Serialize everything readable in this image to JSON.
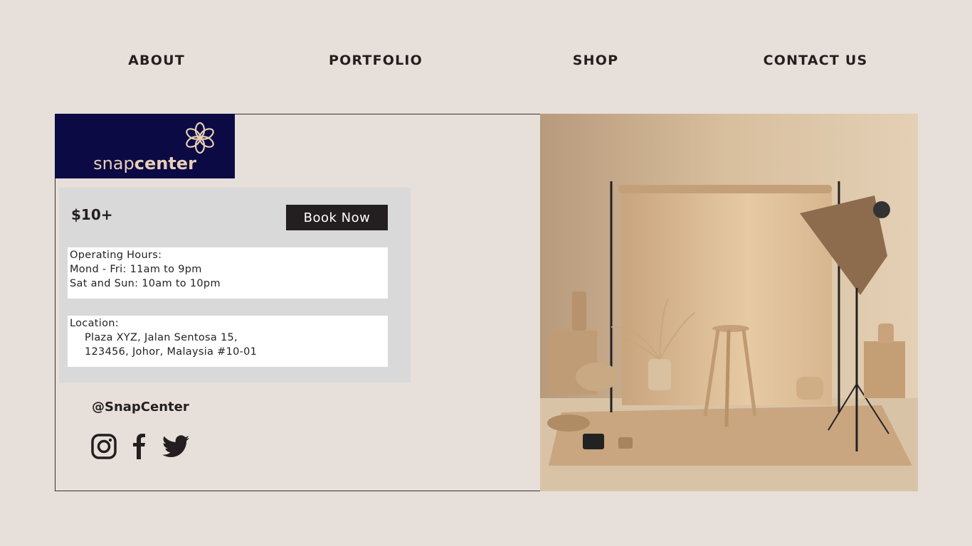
{
  "nav": {
    "items": [
      {
        "label": "ABOUT"
      },
      {
        "label": "PORTFOLIO"
      },
      {
        "label": "SHOP"
      },
      {
        "label": "CONTACT US"
      }
    ]
  },
  "logo": {
    "text_light": "snap",
    "text_bold": "center",
    "icon": "flower-logo-icon",
    "bg_color": "#0b0a45",
    "accent": "#e8cfb5"
  },
  "booking": {
    "price": "$10+",
    "book_label": "Book Now"
  },
  "hours": {
    "title": "Operating Hours:",
    "lines": [
      "Mond - Fri: 11am to 9pm",
      "Sat and Sun: 10am to 10pm"
    ]
  },
  "location": {
    "title": "Location:",
    "lines": [
      "Plaza XYZ, Jalan Sentosa 15,",
      "123456, Johor, Malaysia #10-01"
    ]
  },
  "social": {
    "handle": "@SnapCenter",
    "icons": [
      "instagram-icon",
      "facebook-icon",
      "twitter-icon"
    ]
  }
}
